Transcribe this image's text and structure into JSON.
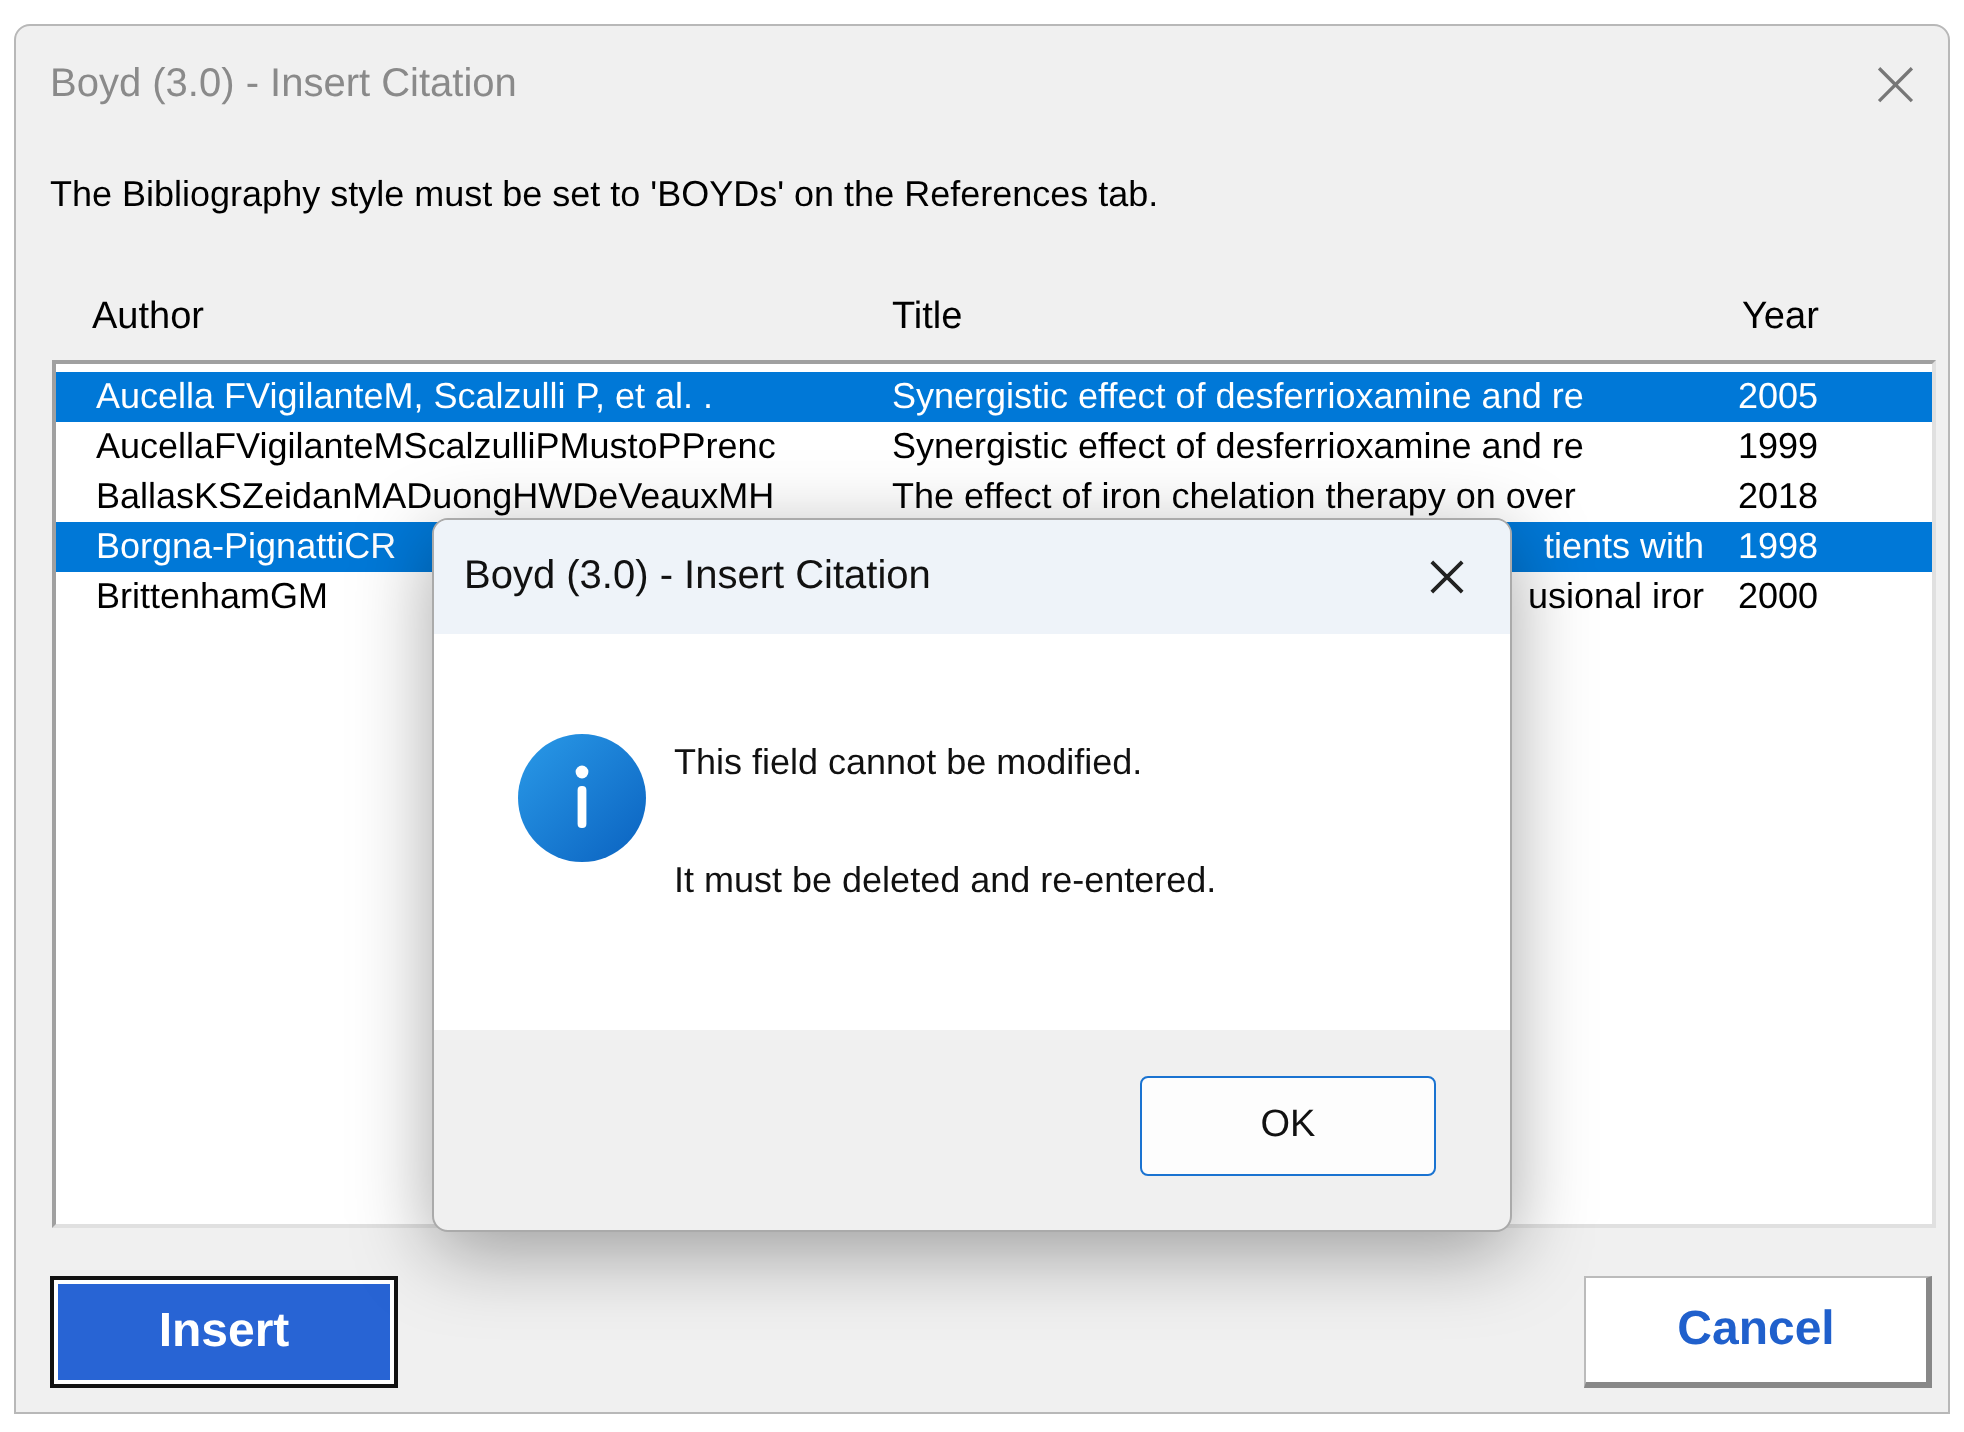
{
  "window": {
    "title": "Boyd (3.0) - Insert Citation",
    "close": "×"
  },
  "message": "The Bibliography style must be set to 'BOYDs' on the References tab.",
  "table": {
    "columns": [
      "Author",
      "Title",
      "Year"
    ],
    "rows": [
      {
        "author": "Aucella FVigilanteM, Scalzulli P, et al. .",
        "title": "Synergistic effect of desferrioxamine and re",
        "year": "2005",
        "selected": true,
        "kind": "full"
      },
      {
        "author": "AucellaFVigilanteMScalzulliPMustoPPrenc",
        "title": "Synergistic effect of desferrioxamine and re",
        "year": "1999",
        "selected": false,
        "kind": "full"
      },
      {
        "author": "BallasKSZeidanMADuongHWDeVeauxMH",
        "title": "The effect of iron chelation therapy on over",
        "year": "2018",
        "selected": false,
        "kind": "full"
      },
      {
        "author": "Borgna-PignattiCR",
        "title": "tients with",
        "year": "1998",
        "selected": true,
        "kind": "cut"
      },
      {
        "author": "BrittenhamGM",
        "title": "usional iror",
        "year": "2000",
        "selected": false,
        "kind": "cut"
      }
    ]
  },
  "buttons": [
    {
      "label": "Insert",
      "kind": "primary"
    },
    {
      "label": "Cancel",
      "kind": "secondary"
    }
  ],
  "dialog": {
    "title": "Boyd (3.0) - Insert Citation",
    "lines": [
      "This field cannot be modified.",
      "It must be deleted and re-entered."
    ],
    "button": "OK"
  }
}
